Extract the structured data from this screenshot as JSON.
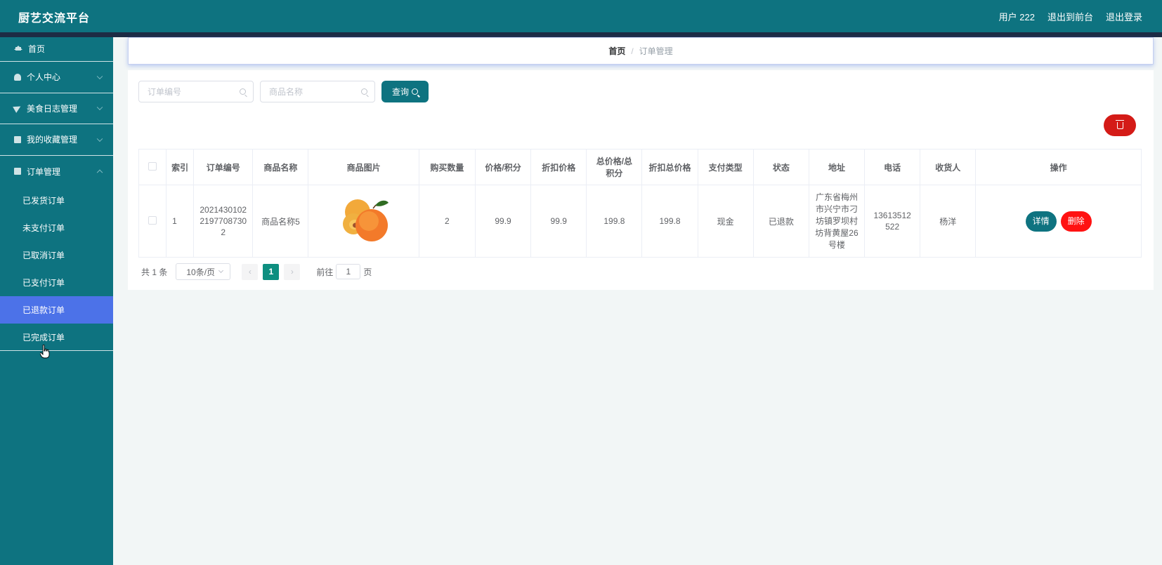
{
  "header": {
    "brand": "厨艺交流平台",
    "user": "用户 222",
    "to_front": "退出到前台",
    "logout": "退出登录"
  },
  "sidebar": {
    "items": [
      {
        "label": "首页",
        "icon": "home-icon"
      },
      {
        "label": "个人中心",
        "icon": "user-icon"
      },
      {
        "label": "美食日志管理",
        "icon": "send-icon"
      },
      {
        "label": "我的收藏管理",
        "icon": "box-icon"
      },
      {
        "label": "订单管理",
        "icon": "box-icon"
      }
    ],
    "sub_items": [
      "已发货订单",
      "未支付订单",
      "已取消订单",
      "已支付订单",
      "已退款订单",
      "已完成订单"
    ],
    "active_sub": "已退款订单"
  },
  "breadcrumb": {
    "home": "首页",
    "separator": "/",
    "current": "订单管理"
  },
  "search": {
    "order_no_placeholder": "订单编号",
    "product_name_placeholder": "商品名称",
    "query_label": "查询"
  },
  "table": {
    "headers": [
      "索引",
      "订单编号",
      "商品名称",
      "商品图片",
      "购买数量",
      "价格/积分",
      "折扣价格",
      "总价格/总积分",
      "折扣总价格",
      "支付类型",
      "状态",
      "地址",
      "电话",
      "收货人",
      "操作"
    ],
    "rows": [
      {
        "index": "1",
        "order_no": "202143010221977087302",
        "product_name": "商品名称5",
        "image": "apricot",
        "quantity": "2",
        "price": "99.9",
        "discount_price": "99.9",
        "total": "199.8",
        "discount_total": "199.8",
        "pay_type": "现金",
        "status": "已退款",
        "address": "广东省梅州市兴宁市刁坊镇罗坝村坊背黄屋26号楼",
        "phone": "13613512522",
        "receiver": "杨洋",
        "detail_label": "详情",
        "delete_label": "删除"
      }
    ]
  },
  "pagination": {
    "total": "共 1 条",
    "page_size": "10条/页",
    "current_page": "1",
    "goto_label": "前往",
    "goto_value": "1",
    "page_unit": "页"
  },
  "colors": {
    "primary": "#0e7380",
    "active_menu": "#4c72e8",
    "danger": "#d41b17",
    "delete": "#ff1212"
  }
}
